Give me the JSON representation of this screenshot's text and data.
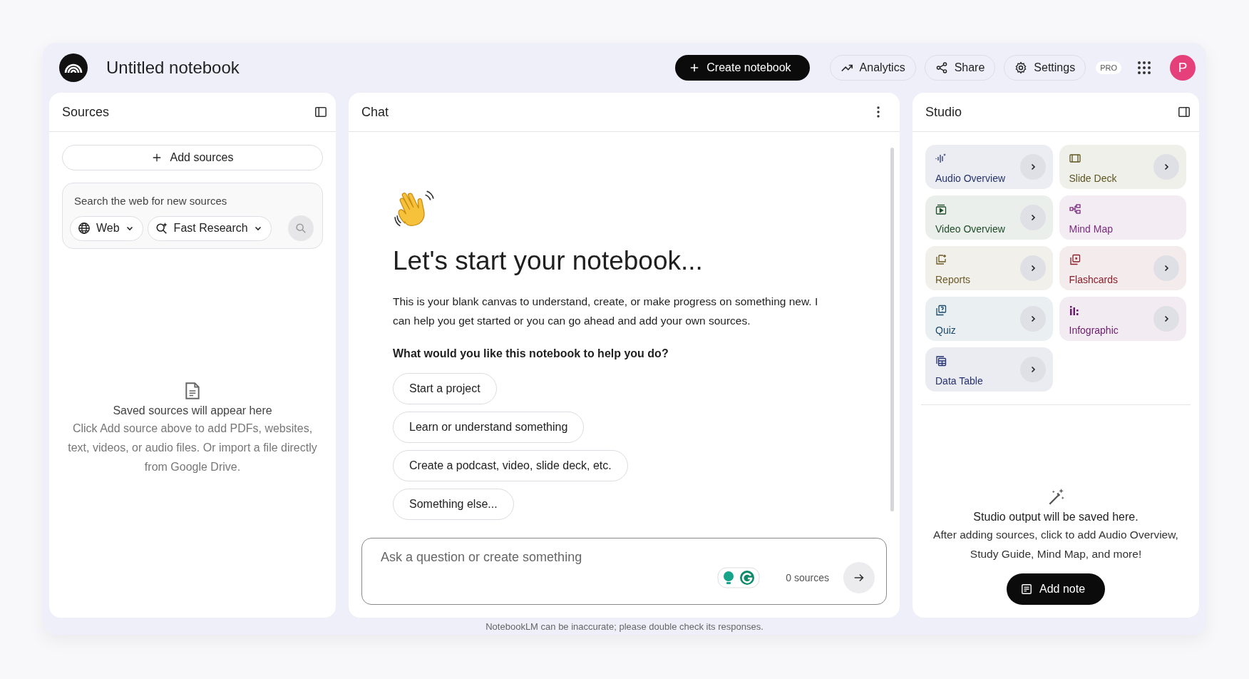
{
  "header": {
    "title": "Untitled notebook",
    "create_button": "Create notebook",
    "badge": "PRO",
    "avatar": "P",
    "actions": [
      {
        "label": "Analytics",
        "kind": "analytics"
      },
      {
        "label": "Share",
        "kind": "share"
      },
      {
        "label": "Settings",
        "kind": "settings"
      }
    ]
  },
  "sources": {
    "title": "Sources",
    "add_button": "Add sources",
    "search": {
      "placeholder": "Search the web for new sources",
      "chips": [
        {
          "label": "Web",
          "kind": "web"
        },
        {
          "label": "Fast Research",
          "kind": "research"
        }
      ]
    },
    "empty_title": "Saved sources will appear here",
    "empty_text": "Click Add source above to add PDFs, websites, text, videos, or audio files. Or import a file directly from Google Drive."
  },
  "chat": {
    "title": "Chat",
    "heading": "Let's start your notebook...",
    "intro": "This is your blank canvas to understand, create, or make progress on something new. I can help you get started or you can go ahead and add your own sources.",
    "question": "What would you like this notebook to help you do?",
    "suggestions": [
      "Start a project",
      "Learn or understand something",
      "Create a podcast, video, slide deck, etc.",
      "Something else..."
    ],
    "input": {
      "placeholder": "Ask a question or create something",
      "count": "0 sources"
    }
  },
  "studio": {
    "title": "Studio",
    "tiles": [
      {
        "label": "Audio Overview",
        "kind": "audio",
        "color": "#27336b",
        "chevron": true
      },
      {
        "label": "Slide Deck",
        "kind": "slides",
        "color": "#5c5520",
        "chevron": true
      },
      {
        "label": "Video Overview",
        "kind": "video",
        "color": "#1f4d2a",
        "chevron": true
      },
      {
        "label": "Mind Map",
        "kind": "mindmap",
        "color": "#7a2a7e",
        "chevron": false
      },
      {
        "label": "Reports",
        "kind": "reports",
        "color": "#6b5a26",
        "chevron": true
      },
      {
        "label": "Flashcards",
        "kind": "flashcards",
        "color": "#8a1e2a",
        "chevron": true
      },
      {
        "label": "Quiz",
        "kind": "quiz",
        "color": "#1b4a6b",
        "chevron": true
      },
      {
        "label": "Infographic",
        "kind": "infographic",
        "color": "#6b1d6b",
        "chevron": true
      },
      {
        "label": "Data Table",
        "kind": "table",
        "color": "#253170",
        "chevron": true
      }
    ],
    "empty_title": "Studio output will be saved here.",
    "empty_text": "After adding sources, click to add Audio Overview, Study Guide, Mind Map, and more!",
    "add_note": "Add note"
  },
  "footer": "NotebookLM can be inaccurate; please double check its responses."
}
